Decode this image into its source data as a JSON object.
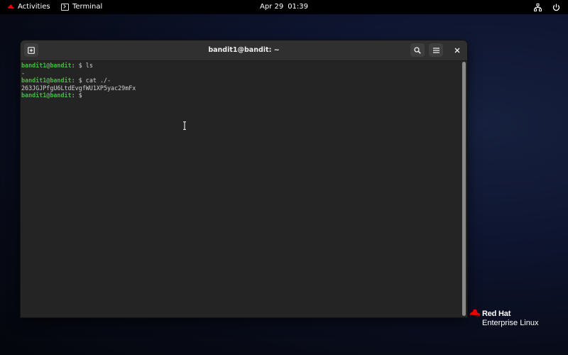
{
  "topbar": {
    "activities_label": "Activities",
    "app_label": "Terminal",
    "date": "Apr 29",
    "time": "01:39"
  },
  "window": {
    "title": "bandit1@bandit: ~"
  },
  "terminal": {
    "lines": [
      {
        "prompt": "bandit1@bandit",
        "sep": ":",
        "path": " $ ",
        "command": "ls"
      },
      {
        "output": "-"
      },
      {
        "prompt": "bandit1@bandit",
        "sep": ":",
        "path": " $ ",
        "command": "cat ./-"
      },
      {
        "output": "263JGJPfgU6LtdEvgfWU1XP5yac29mFx"
      },
      {
        "prompt": "bandit1@bandit",
        "sep": ":",
        "path": " $ ",
        "command": ""
      }
    ]
  },
  "logo": {
    "brand": "Red Hat",
    "product": "Enterprise Linux"
  },
  "colors": {
    "prompt": "#4cb848",
    "redhat_red": "#ee0000",
    "topbar_bg": "#000000",
    "terminal_bg": "#242424",
    "headerbar_bg": "#303030"
  },
  "icons": {
    "activities": "redhat-hat-icon",
    "app": "terminal-icon",
    "new_tab": "new-tab-icon",
    "search": "search-icon",
    "menu": "hamburger-menu-icon",
    "close": "close-icon",
    "network": "network-icon",
    "power": "power-icon"
  }
}
